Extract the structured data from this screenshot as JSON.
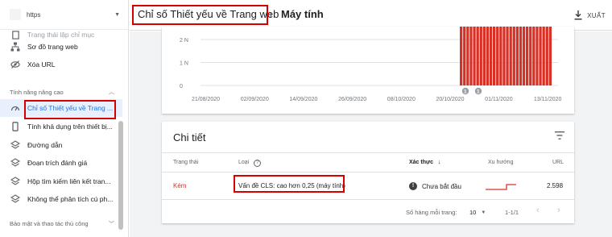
{
  "sidebar": {
    "property": "https",
    "items_top": [
      {
        "label": "Trạng thái lập chỉ mục",
        "icon": "index-icon"
      },
      {
        "label": "Sơ đồ trang web",
        "icon": "sitemap-icon"
      },
      {
        "label": "Xóa URL",
        "icon": "eye-off-icon"
      }
    ],
    "section_enhancements": "Tính năng nâng cao",
    "items": [
      {
        "label": "Chỉ số Thiết yếu về Trang ...",
        "icon": "speed-icon"
      },
      {
        "label": "Tính khả dụng trên thiết bị...",
        "icon": "mobile-icon"
      },
      {
        "label": "Đường dẫn",
        "icon": "layers-icon"
      },
      {
        "label": "Đoạn trích đánh giá",
        "icon": "layers-icon"
      },
      {
        "label": "Hộp tìm kiếm liên kết tran...",
        "icon": "layers-icon"
      },
      {
        "label": "Không thể phân tích cú ph...",
        "icon": "layers-icon"
      }
    ],
    "section_security": "Bảo mật và thao tác thủ công"
  },
  "header": {
    "report": "Chỉ số Thiết yếu về Trang web",
    "page": "Máy tính",
    "export": "XUẤT"
  },
  "chart_data": {
    "type": "bar",
    "y_tick_labels": [
      "2 N",
      "1 N",
      "0"
    ],
    "x_tick_labels": [
      "21/08/2020",
      "02/09/2020",
      "14/09/2020",
      "26/09/2020",
      "08/10/2020",
      "20/10/2020",
      "01/11/2020",
      "13/11/2020"
    ],
    "bar_color": "#d93025",
    "series": [
      {
        "values": [
          2598,
          2598,
          2598,
          2598,
          2598,
          2598,
          2598,
          2598,
          2598,
          2598,
          2598,
          2598,
          2598,
          2598,
          2598,
          2598,
          2598,
          2598,
          2598,
          2598,
          2598,
          2598,
          2598,
          2598,
          2598,
          2598,
          2598,
          2598
        ]
      }
    ],
    "annotations": [
      "1",
      "1"
    ]
  },
  "details": {
    "title": "Chi tiết",
    "columns": {
      "status": "Trang thái",
      "type": "Loại",
      "validation": "Xác thực",
      "trend": "Xu hướng",
      "urls": "URL"
    },
    "row": {
      "status": "Kém",
      "type": "Vấn đề CLS: cao hơn 0,25 (máy tính)",
      "validation": "Chưa bắt đầu",
      "urls": "2.598"
    },
    "footer": {
      "rows_per_page_label": "Số hàng mỗi trang:",
      "rows_per_page": "10",
      "range": "1-1/1"
    }
  }
}
